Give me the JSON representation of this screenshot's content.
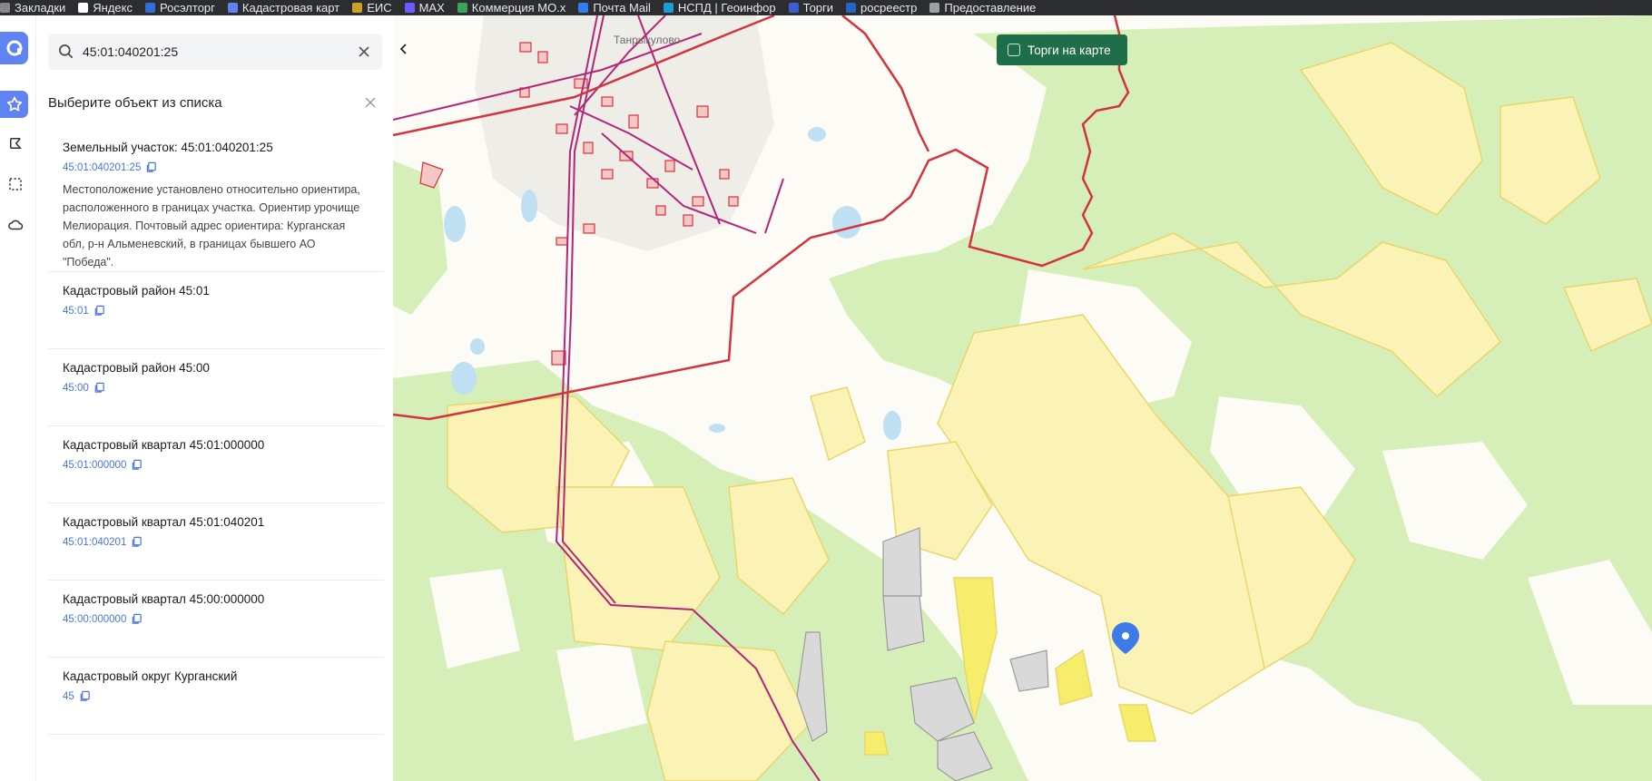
{
  "bookmarks": [
    {
      "label": "Закладки",
      "icon": "bookmark-icon",
      "color": "#888888"
    },
    {
      "label": "Яндекс",
      "icon": "yandex-icon",
      "color": "#ffffff"
    },
    {
      "label": "Росэлторг",
      "icon": "roseltorg-icon",
      "color": "#2f6fdb"
    },
    {
      "label": "Кадастровая карт",
      "icon": "cadastral-map-icon",
      "color": "#5f83f2"
    },
    {
      "label": "ЕИС",
      "icon": "eis-icon",
      "color": "#c9a227"
    },
    {
      "label": "MAX",
      "icon": "max-icon",
      "color": "#6a5cff"
    },
    {
      "label": "Коммерция МО.х",
      "icon": "commerce-icon",
      "color": "#3aa55a"
    },
    {
      "label": "Почта Mail",
      "icon": "mail-icon",
      "color": "#2f7ef5"
    },
    {
      "label": "НСПД | Геоинфор",
      "icon": "nspd-icon",
      "color": "#1d9bd7"
    },
    {
      "label": "Торги",
      "icon": "torgi-icon",
      "color": "#3b5fd1"
    },
    {
      "label": "росреестр",
      "icon": "rosreestr-icon",
      "color": "#2a63c8"
    },
    {
      "label": "Предоставление",
      "icon": "gosuslugi-icon",
      "color": "#9aa0a6"
    }
  ],
  "search": {
    "value": "45:01:040201:25",
    "placeholder": ""
  },
  "selection": {
    "title": "Выберите объект из списка"
  },
  "items": [
    {
      "title": "Земельный участок: 45:01:040201:25",
      "code": "45:01:040201:25",
      "desc": "Местоположение установлено относительно ориентира, расположенного в границах участка. Ориентир урочище Мелиорация. Почтовый адрес ориентира: Курганская обл, р-н Альменевский, в границах бывшего АО \"Победа\"."
    },
    {
      "title": "Кадастровый район 45:01",
      "code": "45:01",
      "desc": ""
    },
    {
      "title": "Кадастровый район 45:00",
      "code": "45:00",
      "desc": ""
    },
    {
      "title": "Кадастровый квартал 45:01:000000",
      "code": "45:01:000000",
      "desc": ""
    },
    {
      "title": "Кадастровый квартал 45:01:040201",
      "code": "45:01:040201",
      "desc": ""
    },
    {
      "title": "Кадастровый квартал 45:00:000000",
      "code": "45:00:000000",
      "desc": ""
    },
    {
      "title": "Кадастровый округ Курганский",
      "code": "45",
      "desc": ""
    }
  ],
  "map": {
    "torgi_toggle": "Торги на карте",
    "village_label": "Танрыкулово",
    "colors": {
      "forest": "#d6efb8",
      "parcel": "#fbf3b5",
      "parcel_stroke": "#e8d66a",
      "boundary": "#d3333e",
      "road": "#b3267a",
      "marker": "#3c7be8",
      "gray_parcel": "#d9d9d9"
    }
  },
  "colors": {
    "accent": "#5f83f2",
    "link": "#4a74df",
    "torgi_bg": "#1f6e49"
  }
}
